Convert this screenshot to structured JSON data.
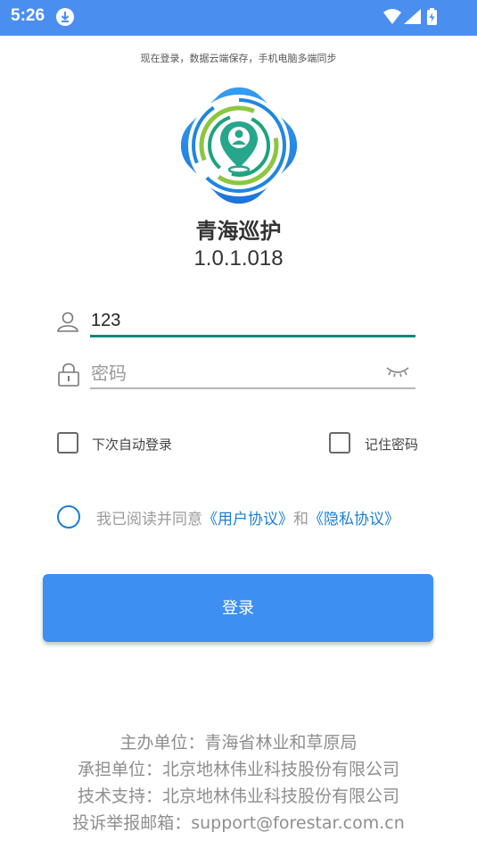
{
  "status_bar": {
    "time": "5:26"
  },
  "header": {
    "subtitle": "现在登录，数据云端保存，手机电脑多端同步"
  },
  "app": {
    "name": "青海巡护",
    "version": "1.0.1.018"
  },
  "login_form": {
    "username_value": "123",
    "password_placeholder": "密码",
    "auto_login_label": "下次自动登录",
    "remember_password_label": "记住密码"
  },
  "agreement": {
    "prefix": "我已阅读并同意",
    "user_agreement": "《用户协议》",
    "conjunction": "和",
    "privacy_agreement": "《隐私协议》"
  },
  "login_button": {
    "label": "登录"
  },
  "footer": {
    "lines": [
      "主办单位：青海省林业和草原局",
      "承担单位：北京地林伟业科技股份有限公司",
      "技术支持：北京地林伟业科技股份有限公司",
      "投诉举报邮箱：support@forestar.com.cn"
    ]
  },
  "colors": {
    "status_bar": "#4a8ff0",
    "accent": "#3d8ff2",
    "link": "#1a7fd6",
    "input_underline_active": "#118a78"
  }
}
